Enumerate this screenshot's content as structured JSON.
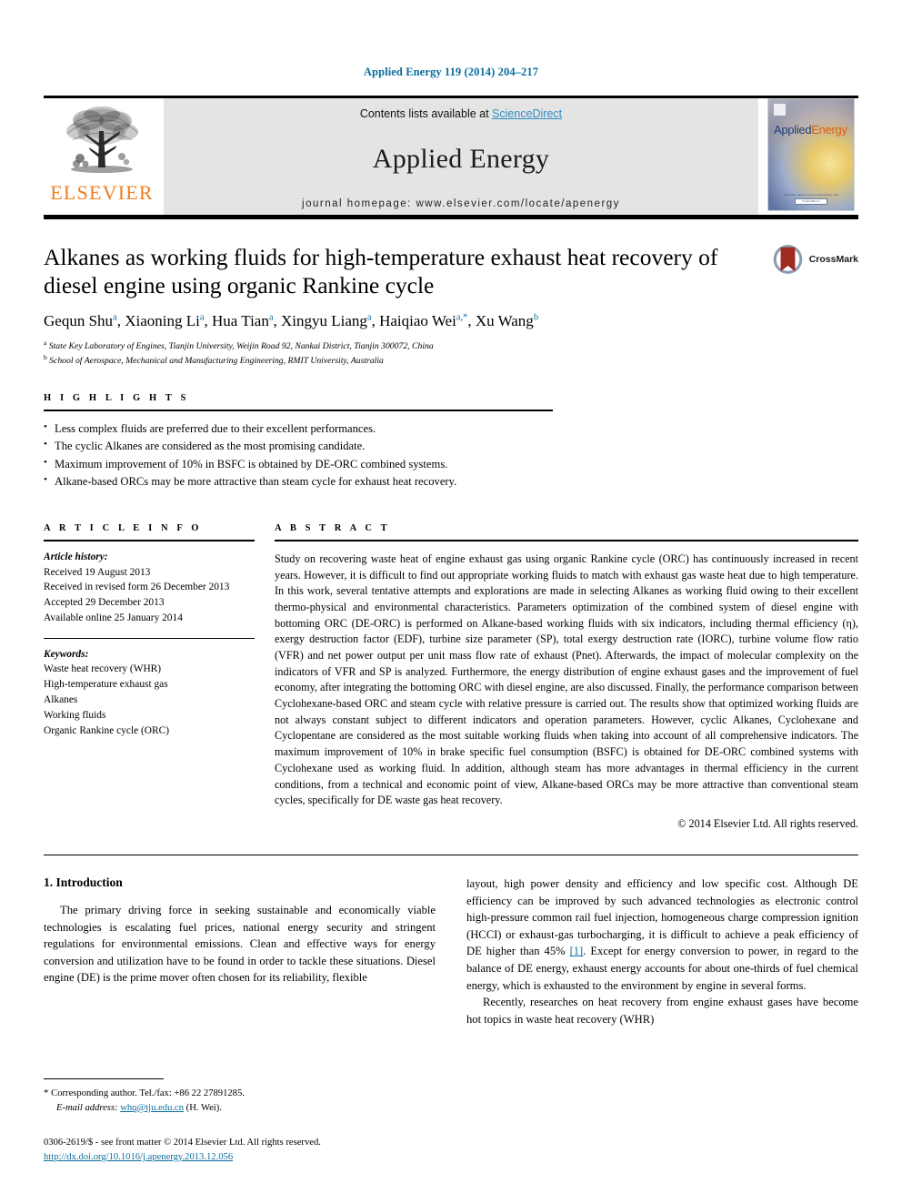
{
  "running_head": "Applied Energy 119 (2014) 204–217",
  "masthead": {
    "publisher_wordmark": "ELSEVIER",
    "contents_prefix": "Contents lists available at ",
    "contents_link": "ScienceDirect",
    "journal_title": "Applied Energy",
    "homepage": "journal homepage: www.elsevier.com/locate/apenergy",
    "cover": {
      "title_part_a": "Applied",
      "title_part_b": "Energy",
      "foot_text": "Available online at www.sciencedirect.com",
      "foot_badge": "ScienceDirect"
    }
  },
  "article": {
    "title": "Alkanes as working fluids for high-temperature exhaust heat recovery of diesel engine using organic Rankine cycle",
    "authors": [
      {
        "name": "Gequn Shu",
        "marks": "a"
      },
      {
        "name": "Xiaoning Li",
        "marks": "a"
      },
      {
        "name": "Hua Tian",
        "marks": "a"
      },
      {
        "name": "Xingyu Liang",
        "marks": "a"
      },
      {
        "name": "Haiqiao Wei",
        "marks": "a,*"
      },
      {
        "name": "Xu Wang",
        "marks": "b"
      }
    ],
    "affiliations": [
      {
        "mark": "a",
        "text": "State Key Laboratory of Engines, Tianjin University, Weijin Road 92, Nankai District, Tianjin 300072, China"
      },
      {
        "mark": "b",
        "text": "School of Aerospace, Mechanical and Manufacturing Engineering, RMIT University, Australia"
      }
    ],
    "crossmark_label": "CrossMark"
  },
  "highlights": {
    "heading": "H I G H L I G H T S",
    "items": [
      "Less complex fluids are preferred due to their excellent performances.",
      "The cyclic Alkanes are considered as the most promising candidate.",
      "Maximum improvement of 10% in BSFC is obtained by DE-ORC combined systems.",
      "Alkane-based ORCs may be more attractive than steam cycle for exhaust heat recovery."
    ]
  },
  "article_info": {
    "heading": "A R T I C L E    I N F O",
    "history_label": "Article history:",
    "history": [
      "Received 19 August 2013",
      "Received in revised form 26 December 2013",
      "Accepted 29 December 2013",
      "Available online 25 January 2014"
    ],
    "keywords_label": "Keywords:",
    "keywords": [
      "Waste heat recovery (WHR)",
      "High-temperature exhaust gas",
      "Alkanes",
      "Working fluids",
      "Organic Rankine cycle (ORC)"
    ]
  },
  "abstract": {
    "heading": "A B S T R A C T",
    "text": "Study on recovering waste heat of engine exhaust gas using organic Rankine cycle (ORC) has continuously increased in recent years. However, it is difficult to find out appropriate working fluids to match with exhaust gas waste heat due to high temperature. In this work, several tentative attempts and explorations are made in selecting Alkanes as working fluid owing to their excellent thermo-physical and environmental characteristics. Parameters optimization of the combined system of diesel engine with bottoming ORC (DE-ORC) is performed on Alkane-based working fluids with six indicators, including thermal efficiency (η), exergy destruction factor (EDF), turbine size parameter (SP), total exergy destruction rate (IORC), turbine volume flow ratio (VFR) and net power output per unit mass flow rate of exhaust (Pnet). Afterwards, the impact of molecular complexity on the indicators of VFR and SP is analyzed. Furthermore, the energy distribution of engine exhaust gases and the improvement of fuel economy, after integrating the bottoming ORC with diesel engine, are also discussed. Finally, the performance comparison between Cyclohexane-based ORC and steam cycle with relative pressure is carried out. The results show that optimized working fluids are not always constant subject to different indicators and operation parameters. However, cyclic Alkanes, Cyclohexane and Cyclopentane are considered as the most suitable working fluids when taking into account of all comprehensive indicators. The maximum improvement of 10% in brake specific fuel consumption (BSFC) is obtained for DE-ORC combined systems with Cyclohexane used as working fluid. In addition, although steam has more advantages in thermal efficiency in the current conditions, from a technical and economic point of view, Alkane-based ORCs may be more attractive than conventional steam cycles, specifically for DE waste gas heat recovery.",
    "copyright": "© 2014 Elsevier Ltd. All rights reserved."
  },
  "body": {
    "section_heading": "1. Introduction",
    "left_paragraph": "The primary driving force in seeking sustainable and economically viable technologies is escalating fuel prices, national energy security and stringent regulations for environmental emissions. Clean and effective ways for energy conversion and utilization have to be found in order to tackle these situations. Diesel engine (DE) is the prime mover often chosen for its reliability, flexible",
    "right_paragraph_1_a": "layout, high power density and efficiency and low specific cost. Although DE efficiency can be improved by such advanced technologies as electronic control high-pressure common rail fuel injection, homogeneous charge compression ignition (HCCI) or exhaust-gas turbocharging, it is difficult to achieve a peak efficiency of DE higher than 45% ",
    "right_paragraph_1_cite": "[1]",
    "right_paragraph_1_b": ". Except for energy conversion to power, in regard to the balance of DE energy, exhaust energy accounts for about one-thirds of fuel chemical energy, which is exhausted to the environment by engine in several forms.",
    "right_paragraph_2": "Recently, researches on heat recovery from engine exhaust gases have become hot topics in waste heat recovery (WHR)"
  },
  "footer": {
    "corresponding_star": "*",
    "corresponding_text": "Corresponding author. Tel./fax: +86 22 27891285.",
    "email_label": "E-mail address:",
    "email": "whq@tju.edu.cn",
    "email_suffix": "(H. Wei).",
    "issn_line": "0306-2619/$ - see front matter © 2014 Elsevier Ltd. All rights reserved.",
    "doi": "http://dx.doi.org/10.1016/j.apenergy.2013.12.056"
  },
  "colors": {
    "link": "#0c6e9e",
    "elsevier_orange": "#f07d1a",
    "band_gray": "#e4e4e4"
  }
}
